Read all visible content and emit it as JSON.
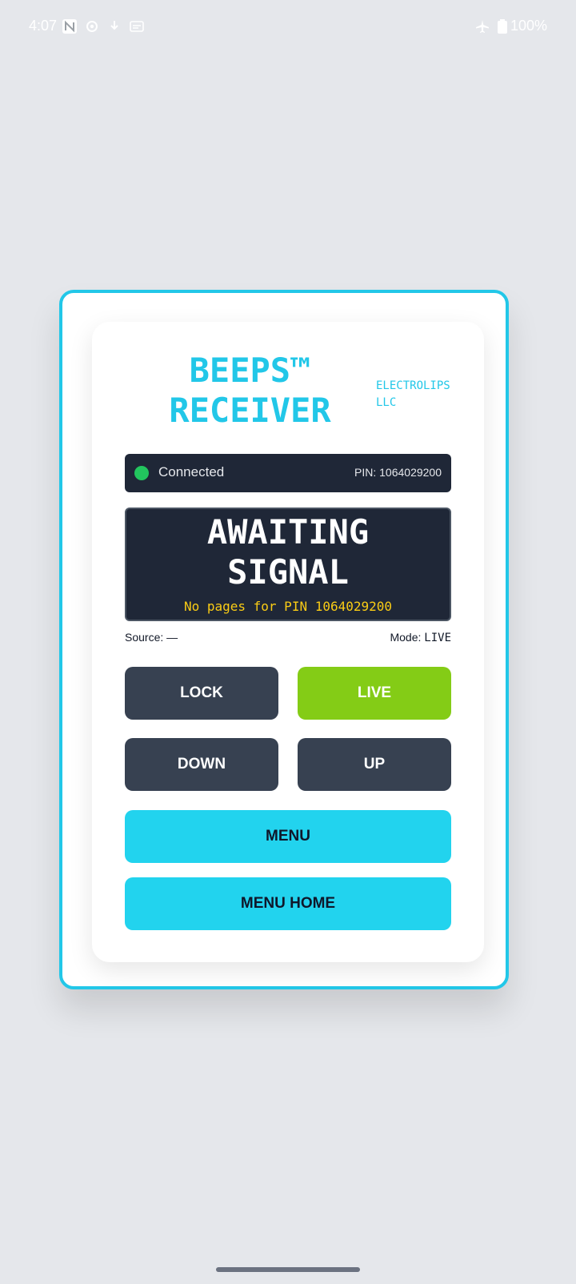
{
  "status_bar": {
    "time": "4:07",
    "icons_left": [
      "n-badge-icon",
      "gear-icon",
      "download-icon",
      "subtitles-icon"
    ],
    "icons_right": [
      "airplane-icon",
      "battery-icon"
    ],
    "battery": "100%"
  },
  "header": {
    "title_line1": "BEEPS™",
    "title_line2": "RECEIVER",
    "brand_line1": "ELECTROLIPS",
    "brand_line2": "LLC"
  },
  "connection": {
    "status": "Connected",
    "status_color": "#22c55e",
    "pin_label": "PIN: 1064029200"
  },
  "display": {
    "headline_line1": "AWAITING",
    "headline_line2": "SIGNAL",
    "subtext": "No pages for PIN 1064029200"
  },
  "meta": {
    "source_label": "Source:",
    "source_value": "—",
    "mode_label": "Mode:",
    "mode_value": "LIVE"
  },
  "buttons": {
    "lock": "LOCK",
    "live": "LIVE",
    "down": "DOWN",
    "up": "UP",
    "menu": "MENU",
    "menu_home": "MENU HOME"
  },
  "colors": {
    "accent": "#22c7e8",
    "live_green": "#84cc16",
    "dark_button": "#374151",
    "panel": "#1f2737",
    "subtext_yellow": "#facc15"
  }
}
